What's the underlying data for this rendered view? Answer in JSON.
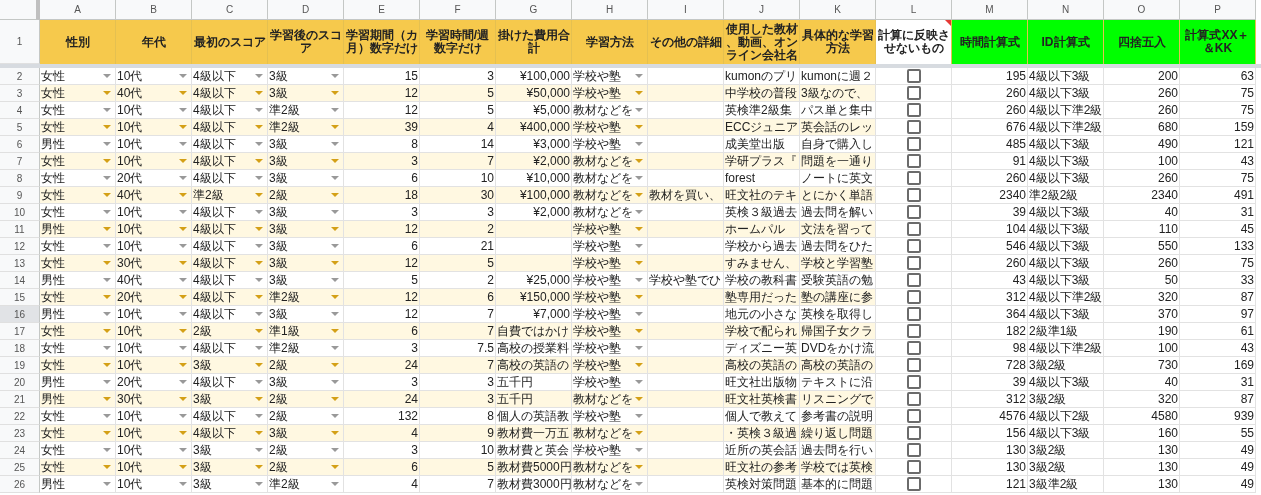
{
  "columns": [
    {
      "letter": "A",
      "title": "性別",
      "color": "#f6c94c"
    },
    {
      "letter": "B",
      "title": "年代",
      "color": "#f6c94c"
    },
    {
      "letter": "C",
      "title": "最初のスコア",
      "color": "#f6c94c"
    },
    {
      "letter": "D",
      "title": "学習後のスコア",
      "color": "#f6c94c"
    },
    {
      "letter": "E",
      "title": "学習期間（カ月）数字だけ",
      "color": "#f6c94c"
    },
    {
      "letter": "F",
      "title": "学習時間/週数字だけ",
      "color": "#f6c94c"
    },
    {
      "letter": "G",
      "title": "掛けた費用合計",
      "color": "#f6c94c"
    },
    {
      "letter": "H",
      "title": "学習方法",
      "color": "#f6c94c"
    },
    {
      "letter": "I",
      "title": "その他の詳細",
      "color": "#f6c94c"
    },
    {
      "letter": "J",
      "title": "使用した教材、動画、オンライン会社名",
      "color": "#f6c94c"
    },
    {
      "letter": "K",
      "title": "具体的な学習方法",
      "color": "#f6c94c"
    },
    {
      "letter": "L",
      "title": "計算に反映させないもの",
      "color": "#ffffff",
      "note": true
    },
    {
      "letter": "M",
      "title": "時間計算式",
      "color": "#00ff00"
    },
    {
      "letter": "N",
      "title": "ID計算式",
      "color": "#00ff00"
    },
    {
      "letter": "O",
      "title": "四捨五入",
      "color": "#00ff00"
    },
    {
      "letter": "P",
      "title": "計算式XX＋＆KK",
      "color": "#00ff00"
    }
  ],
  "header_row_number": "1",
  "rows": [
    {
      "number": "2",
      "selected": false,
      "gender": "女性",
      "age": "10代",
      "first_score": "4級以下",
      "after_score": "3級",
      "months": "15",
      "hours_per_week": "3",
      "cost": "¥100,000",
      "method": "学校や塾",
      "materials": "kumonのプリ",
      "approach": "kumonに週２",
      "excluded": false,
      "time_calc": "195",
      "id_calc": "4級以下3級",
      "rounded": "200",
      "calc_xx_kk": "63"
    },
    {
      "number": "3",
      "selected": false,
      "gender": "女性",
      "age": "40代",
      "first_score": "4級以下",
      "after_score": "3級",
      "months": "12",
      "hours_per_week": "5",
      "cost": "¥50,000",
      "method": "学校や塾",
      "materials": "中学校の普段",
      "approach": "3級なので、",
      "excluded": false,
      "time_calc": "260",
      "id_calc": "4級以下3級",
      "rounded": "260",
      "calc_xx_kk": "75"
    },
    {
      "number": "4",
      "selected": false,
      "gender": "女性",
      "age": "10代",
      "first_score": "4級以下",
      "after_score": "準2級",
      "months": "12",
      "hours_per_week": "5",
      "cost": "¥5,000",
      "method": "教材などを",
      "materials": "英検準2級集",
      "approach": "パス単と集中",
      "excluded": false,
      "time_calc": "260",
      "id_calc": "4級以下準2級",
      "rounded": "260",
      "calc_xx_kk": "75"
    },
    {
      "number": "5",
      "selected": false,
      "gender": "女性",
      "age": "10代",
      "first_score": "4級以下",
      "after_score": "準2級",
      "months": "39",
      "hours_per_week": "4",
      "cost": "¥400,000",
      "method": "学校や塾",
      "materials": "ECCジュニア",
      "approach": "英会話のレッ",
      "excluded": false,
      "time_calc": "676",
      "id_calc": "4級以下準2級",
      "rounded": "680",
      "calc_xx_kk": "159"
    },
    {
      "number": "6",
      "selected": false,
      "gender": "男性",
      "age": "10代",
      "first_score": "4級以下",
      "after_score": "3級",
      "months": "8",
      "hours_per_week": "14",
      "cost": "¥3,000",
      "method": "学校や塾",
      "materials": "成美堂出版",
      "approach": "自身で購入し",
      "excluded": false,
      "time_calc": "485",
      "id_calc": "4級以下3級",
      "rounded": "490",
      "calc_xx_kk": "121"
    },
    {
      "number": "7",
      "selected": false,
      "gender": "女性",
      "age": "10代",
      "first_score": "4級以下",
      "after_score": "3級",
      "months": "3",
      "hours_per_week": "7",
      "cost": "¥2,000",
      "method": "教材などを",
      "materials": "学研プラス『",
      "approach": "問題を一通り",
      "excluded": false,
      "time_calc": "91",
      "id_calc": "4級以下3級",
      "rounded": "100",
      "calc_xx_kk": "43"
    },
    {
      "number": "8",
      "selected": false,
      "gender": "女性",
      "age": "20代",
      "first_score": "4級以下",
      "after_score": "3級",
      "months": "6",
      "hours_per_week": "10",
      "cost": "¥10,000",
      "method": "教材などを",
      "materials": "forest",
      "approach": "ノートに英文",
      "excluded": false,
      "time_calc": "260",
      "id_calc": "4級以下3級",
      "rounded": "260",
      "calc_xx_kk": "75"
    },
    {
      "number": "9",
      "selected": false,
      "gender": "女性",
      "age": "40代",
      "first_score": "準2級",
      "after_score": "2級",
      "months": "18",
      "hours_per_week": "30",
      "cost": "¥100,000",
      "method": "教材などを",
      "other": "教材を買い、",
      "materials": "旺文社のテキ",
      "approach": "とにかく単語",
      "excluded": false,
      "time_calc": "2340",
      "id_calc": "準2級2級",
      "rounded": "2340",
      "calc_xx_kk": "491"
    },
    {
      "number": "10",
      "selected": false,
      "gender": "女性",
      "age": "10代",
      "first_score": "4級以下",
      "after_score": "3級",
      "months": "3",
      "hours_per_week": "3",
      "cost": "¥2,000",
      "method": "教材などを",
      "materials": "英検３級過去",
      "approach": "過去問を解い",
      "excluded": false,
      "time_calc": "39",
      "id_calc": "4級以下3級",
      "rounded": "40",
      "calc_xx_kk": "31"
    },
    {
      "number": "11",
      "selected": false,
      "gender": "男性",
      "age": "10代",
      "first_score": "4級以下",
      "after_score": "3級",
      "months": "12",
      "hours_per_week": "2",
      "method": "学校や塾",
      "materials": "ホームパル",
      "approach": "文法を習って",
      "excluded": false,
      "time_calc": "104",
      "id_calc": "4級以下3級",
      "rounded": "110",
      "calc_xx_kk": "45"
    },
    {
      "number": "12",
      "selected": false,
      "gender": "女性",
      "age": "10代",
      "first_score": "4級以下",
      "after_score": "3級",
      "months": "6",
      "hours_per_week": "21",
      "method": "学校や塾",
      "materials": "学校から過去",
      "approach": "過去問をひた",
      "excluded": false,
      "time_calc": "546",
      "id_calc": "4級以下3級",
      "rounded": "550",
      "calc_xx_kk": "133"
    },
    {
      "number": "13",
      "selected": false,
      "gender": "女性",
      "age": "30代",
      "first_score": "4級以下",
      "after_score": "3級",
      "months": "12",
      "hours_per_week": "5",
      "method": "学校や塾",
      "materials": "すみません、",
      "approach": "学校と学習塾",
      "excluded": false,
      "time_calc": "260",
      "id_calc": "4級以下3級",
      "rounded": "260",
      "calc_xx_kk": "75"
    },
    {
      "number": "14",
      "selected": false,
      "gender": "男性",
      "age": "40代",
      "first_score": "4級以下",
      "after_score": "3級",
      "months": "5",
      "hours_per_week": "2",
      "cost": "¥25,000",
      "method": "学校や塾",
      "other": "学校や塾でひ",
      "materials": "学校の教科書",
      "approach": "受験英語の勉",
      "excluded": false,
      "time_calc": "43",
      "id_calc": "4級以下3級",
      "rounded": "50",
      "calc_xx_kk": "33"
    },
    {
      "number": "15",
      "selected": false,
      "gender": "女性",
      "age": "20代",
      "first_score": "4級以下",
      "after_score": "準2級",
      "months": "12",
      "hours_per_week": "6",
      "cost": "¥150,000",
      "method": "学校や塾",
      "materials": "塾専用だった",
      "approach": "塾の講座に参",
      "excluded": false,
      "time_calc": "312",
      "id_calc": "4級以下準2級",
      "rounded": "320",
      "calc_xx_kk": "87"
    },
    {
      "number": "16",
      "selected": true,
      "gender": "男性",
      "age": "10代",
      "first_score": "4級以下",
      "after_score": "3級",
      "months": "12",
      "hours_per_week": "7",
      "cost": "¥7,000",
      "method": "学校や塾",
      "materials": "地元の小さな",
      "approach": "英検を取得し",
      "excluded": false,
      "time_calc": "364",
      "id_calc": "4級以下3級",
      "rounded": "370",
      "calc_xx_kk": "97"
    },
    {
      "number": "17",
      "selected": false,
      "gender": "女性",
      "age": "10代",
      "first_score": "2級",
      "after_score": "準1級",
      "months": "6",
      "hours_per_week": "7",
      "cost_note": "自費ではかけ",
      "method": "学校や塾",
      "materials": "学校で配られ",
      "approach": "帰国子女クラ",
      "excluded": false,
      "time_calc": "182",
      "id_calc": "2級準1級",
      "rounded": "190",
      "calc_xx_kk": "61"
    },
    {
      "number": "18",
      "selected": false,
      "gender": "女性",
      "age": "10代",
      "first_score": "4級以下",
      "after_score": "準2級",
      "months": "3",
      "hours_per_week": "7.5",
      "cost_note": "高校の授業料",
      "method": "学校や塾",
      "materials": "ディズニー英",
      "approach": "DVDをかけ流",
      "excluded": false,
      "time_calc": "98",
      "id_calc": "4級以下準2級",
      "rounded": "100",
      "calc_xx_kk": "43"
    },
    {
      "number": "19",
      "selected": false,
      "gender": "女性",
      "age": "10代",
      "first_score": "3級",
      "after_score": "2級",
      "months": "24",
      "hours_per_week": "7",
      "cost_note": "高校の英語の",
      "method": "学校や塾",
      "materials": "高校の英語の",
      "approach": "高校の英語の",
      "excluded": false,
      "time_calc": "728",
      "id_calc": "3級2級",
      "rounded": "730",
      "calc_xx_kk": "169"
    },
    {
      "number": "20",
      "selected": false,
      "gender": "男性",
      "age": "20代",
      "first_score": "4級以下",
      "after_score": "3級",
      "months": "3",
      "hours_per_week": "3",
      "cost_note": "五千円",
      "method": "学校や塾",
      "materials": "旺文社出版物",
      "approach": "テキストに沿",
      "excluded": false,
      "time_calc": "39",
      "id_calc": "4級以下3級",
      "rounded": "40",
      "calc_xx_kk": "31"
    },
    {
      "number": "21",
      "selected": false,
      "gender": "男性",
      "age": "30代",
      "first_score": "3級",
      "after_score": "2級",
      "months": "24",
      "hours_per_week": "3",
      "cost_note": "五千円",
      "method": "教材などを",
      "materials": "旺文社英検書",
      "approach": "リスニングで",
      "excluded": false,
      "time_calc": "312",
      "id_calc": "3級2級",
      "rounded": "320",
      "calc_xx_kk": "87"
    },
    {
      "number": "22",
      "selected": false,
      "gender": "女性",
      "age": "10代",
      "first_score": "4級以下",
      "after_score": "2級",
      "months": "132",
      "hours_per_week": "8",
      "cost_note": "個人の英語教",
      "method": "学校や塾",
      "materials": "個人で教えて",
      "approach": "参考書の説明",
      "excluded": false,
      "time_calc": "4576",
      "id_calc": "4級以下2級",
      "rounded": "4580",
      "calc_xx_kk": "939"
    },
    {
      "number": "23",
      "selected": false,
      "gender": "女性",
      "age": "10代",
      "first_score": "4級以下",
      "after_score": "3級",
      "months": "4",
      "hours_per_week": "9",
      "cost_note": "教材費一万五",
      "method": "教材などを",
      "materials": "・英検３級過",
      "approach": "繰り返し問題",
      "excluded": false,
      "time_calc": "156",
      "id_calc": "4級以下3級",
      "rounded": "160",
      "calc_xx_kk": "55"
    },
    {
      "number": "24",
      "selected": false,
      "gender": "女性",
      "age": "10代",
      "first_score": "3級",
      "after_score": "2級",
      "months": "3",
      "hours_per_week": "10",
      "cost_note": "教材費と英会",
      "method": "学校や塾",
      "materials": "近所の英会話",
      "approach": "過去問を行い",
      "excluded": false,
      "time_calc": "130",
      "id_calc": "3級2級",
      "rounded": "130",
      "calc_xx_kk": "49"
    },
    {
      "number": "25",
      "selected": false,
      "gender": "女性",
      "age": "10代",
      "first_score": "3級",
      "after_score": "2級",
      "months": "6",
      "hours_per_week": "5",
      "cost_note": "教材費5000円",
      "method": "教材などを",
      "materials": "旺文社の参考",
      "approach": "学校では英検",
      "excluded": false,
      "time_calc": "130",
      "id_calc": "3級2級",
      "rounded": "130",
      "calc_xx_kk": "49"
    },
    {
      "number": "26",
      "selected": false,
      "gender": "男性",
      "age": "10代",
      "first_score": "3級",
      "after_score": "準2級",
      "months": "4",
      "hours_per_week": "7",
      "cost_note": "教材費3000円",
      "method": "教材などを",
      "materials": "英検対策問題",
      "approach": "基本的に問題",
      "excluded": false,
      "time_calc": "121",
      "id_calc": "3級準2級",
      "rounded": "130",
      "calc_xx_kk": "49"
    }
  ]
}
